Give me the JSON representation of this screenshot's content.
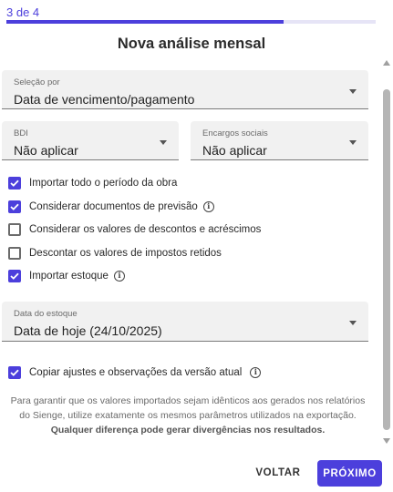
{
  "colors": {
    "accent": "#4c3fdc",
    "field_bg": "#f1f1f1",
    "scrollbar": "#b5b5b5"
  },
  "progress": {
    "step_text": "3 de 4",
    "fraction": 0.75
  },
  "title": "Nova análise mensal",
  "fields": {
    "selecao": {
      "label": "Seleção por",
      "value": "Data de vencimento/pagamento",
      "icon": "chevron-down-icon"
    },
    "bdi": {
      "label": "BDI",
      "value": "Não aplicar",
      "icon": "chevron-down-icon"
    },
    "encargos": {
      "label": "Encargos sociais",
      "value": "Não aplicar",
      "icon": "chevron-down-icon"
    },
    "estoque": {
      "label": "Data do estoque",
      "value": "Data de hoje (24/10/2025)",
      "icon": "chevron-down-icon"
    }
  },
  "checks": {
    "importar_periodo": {
      "label": "Importar todo o período da obra",
      "checked": true
    },
    "considerar_previsao": {
      "label": "Considerar documentos de previsão",
      "checked": true
    },
    "considerar_descontos": {
      "label": "Considerar os valores de descontos e acréscimos",
      "checked": false
    },
    "descontar_impostos": {
      "label": "Descontar os valores de impostos retidos",
      "checked": false
    },
    "importar_estoque": {
      "label": "Importar estoque",
      "checked": true
    },
    "copiar_ajustes": {
      "label": "Copiar ajustes e observações da versão atual",
      "checked": true
    }
  },
  "info_icon_glyph": "i",
  "notice": {
    "text": "Para garantir que os valores importados sejam idênticos aos gerados nos relatórios do Sienge, utilize exatamente os mesmos parâmetros utilizados na exportação.",
    "bold": "Qualquer diferença pode gerar divergências nos resultados."
  },
  "buttons": {
    "back": "VOLTAR",
    "next": "PRÓXIMO"
  }
}
